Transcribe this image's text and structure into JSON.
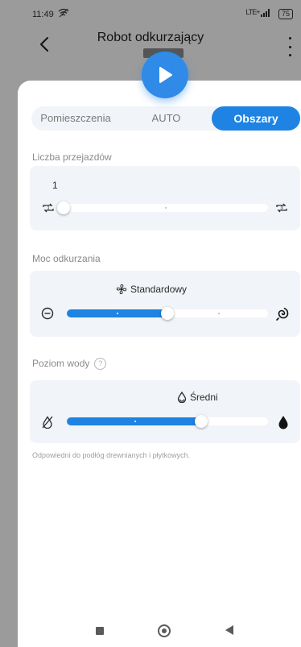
{
  "status_bar": {
    "time": "11:49",
    "signal": "LTE+",
    "battery": "75"
  },
  "header": {
    "title": "Robot odkurzający"
  },
  "tabs": [
    {
      "label": "Pomieszczenia",
      "selected": false
    },
    {
      "label": "AUTO",
      "selected": false
    },
    {
      "label": "Obszary",
      "selected": true
    }
  ],
  "passes": {
    "title": "Liczba przejazdów",
    "value": "1",
    "min": 1,
    "max": 3,
    "min_icon": "repeat-1-icon",
    "max_icon": "repeat-3-icon"
  },
  "suction": {
    "title": "Moc odkurzania",
    "level_label": "Standardowy",
    "level_fraction": 0.5,
    "icon": "fan-icon",
    "min_icon": "quiet-icon",
    "max_icon": "max-suction-icon"
  },
  "water": {
    "title": "Poziom wody",
    "level_label": "Średni",
    "level_fraction": 0.67,
    "icon": "droplet-outline-icon",
    "min_icon": "no-water-icon",
    "max_icon": "droplet-filled-icon"
  },
  "hint": "Odpowiedni do podłóg drewnianych i płytkowych.",
  "colors": {
    "accent": "#1e83e2",
    "card_bg": "#f1f4f8",
    "header_bg": "#9b9b9b"
  }
}
